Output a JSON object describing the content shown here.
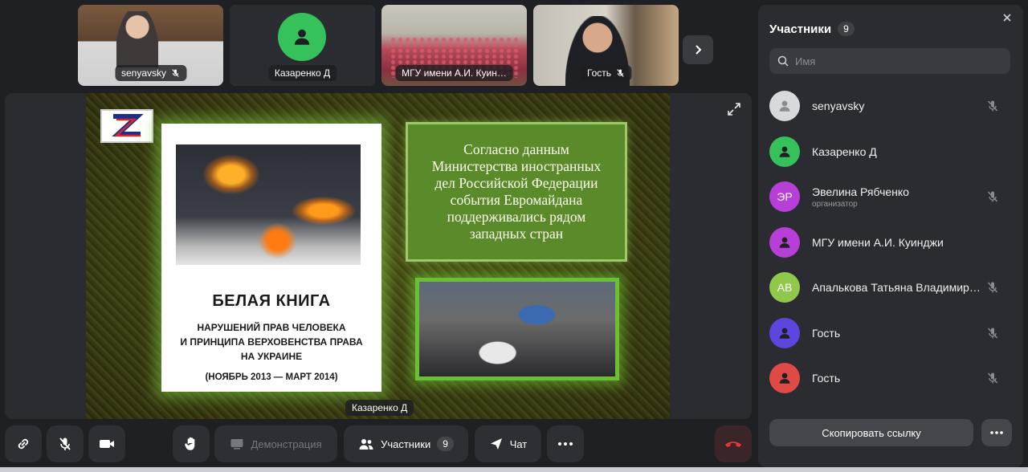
{
  "thumbnails": [
    {
      "label": "senyavsky",
      "muted": true,
      "scene": "office"
    },
    {
      "label": "Казаренко Д",
      "muted": false,
      "scene": "avatar",
      "active": true
    },
    {
      "label": "МГУ имени А.И. Куин…",
      "muted": false,
      "scene": "hall"
    },
    {
      "label": "Гость",
      "muted": true,
      "scene": "guest"
    }
  ],
  "stage": {
    "speaker_name": "Казаренко Д",
    "slide": {
      "book_title": "БЕЛАЯ КНИГА",
      "book_subtitle": "НАРУШЕНИЙ ПРАВ ЧЕЛОВЕКА\nИ ПРИНЦИПА ВЕРХОВЕНСТВА ПРАВА\nНА УКРАИНЕ",
      "book_date": "(НОЯБРЬ 2013 — МАРТ 2014)",
      "text_box": "Согласно данным\nМинистерства иностранных\nдел Российской Федерации\nсобытия Евромайдана\nподдерживались рядом\nзападных стран"
    }
  },
  "toolbar": {
    "demo_label": "Демонстрация",
    "participants_label": "Участники",
    "participants_count": "9",
    "chat_label": "Чат"
  },
  "sidebar": {
    "title": "Участники",
    "count": "9",
    "search_placeholder": "Имя",
    "participants": [
      {
        "name": "senyavsky",
        "initials": "",
        "role": "",
        "color": "#d8d9dd",
        "muted": true,
        "avatar": "person-grey"
      },
      {
        "name": "Казаренко Д",
        "initials": "",
        "role": "",
        "color": "#36c25b",
        "muted": false,
        "avatar": "person"
      },
      {
        "name": "Эвелина Рябченко",
        "initials": "ЭР",
        "role": "организатор",
        "color": "#b73fd8",
        "muted": true,
        "avatar": "initials"
      },
      {
        "name": "МГУ имени А.И. Куинджи",
        "initials": "",
        "role": "",
        "color": "#b73fd8",
        "muted": false,
        "avatar": "person"
      },
      {
        "name": "Апалькова Татьяна Владимировна",
        "initials": "АВ",
        "role": "",
        "color": "#8fc84a",
        "muted": true,
        "avatar": "initials"
      },
      {
        "name": "Гость",
        "initials": "",
        "role": "",
        "color": "#5a47e0",
        "muted": true,
        "avatar": "person"
      },
      {
        "name": "Гость",
        "initials": "",
        "role": "",
        "color": "#e04a45",
        "muted": true,
        "avatar": "person"
      }
    ],
    "copy_link_label": "Скопировать ссылку"
  },
  "colors": {
    "accent_green": "#36c25b",
    "background": "#1f2024",
    "panel": "#2b2c31"
  }
}
